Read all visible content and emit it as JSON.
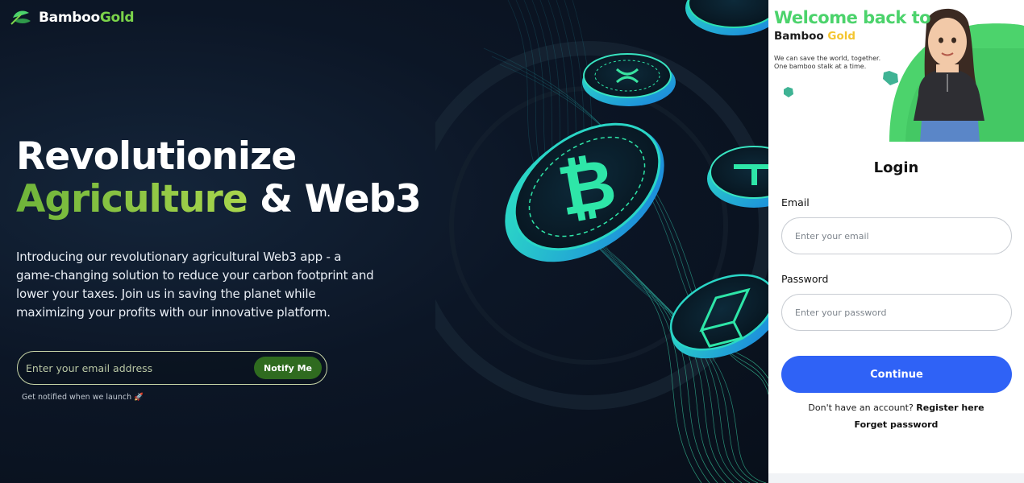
{
  "brand": {
    "name_main": "Bamboo",
    "name_accent": "Gold"
  },
  "hero": {
    "headline_line1": "Revolutionize",
    "headline_accent": "Agriculture",
    "headline_rest": " & Web3",
    "intro": "Introducing our revolutionary agricultural Web3 app - a game-changing solution to reduce your carbon footprint and lower your taxes. Join us in saving the planet while maximizing your profits with our innovative platform.",
    "email_placeholder": "Enter your email address",
    "notify_button": "Notify Me",
    "notify_hint": "Get notified when we launch 🚀"
  },
  "login_panel": {
    "welcome_title": "Welcome back to",
    "brand_main": "Bamboo",
    "brand_accent": "Gold",
    "tagline_line1": "We can save the world, together.",
    "tagline_line2": "One bamboo stalk at a time.",
    "title": "Login",
    "email_label": "Email",
    "email_placeholder": "Enter your email",
    "password_label": "Password",
    "password_placeholder": "Enter your password",
    "continue_button": "Continue",
    "no_account_text": "Don't have an account?",
    "register_link": "Register here",
    "forget_link": "Forget password"
  },
  "colors": {
    "accent_green": "#4cd36c",
    "brand_gold": "#f4c530",
    "primary_blue": "#2f62f6",
    "notify_green": "#2f6b1f",
    "background_dark": "#0b1320"
  },
  "icons": {
    "logo": "bamboo-leaf-icon",
    "coins": [
      "ripple-coin-icon",
      "bitcoin-coin-icon",
      "tether-coin-icon",
      "block-coin-icon"
    ],
    "launch": "rocket-icon"
  }
}
